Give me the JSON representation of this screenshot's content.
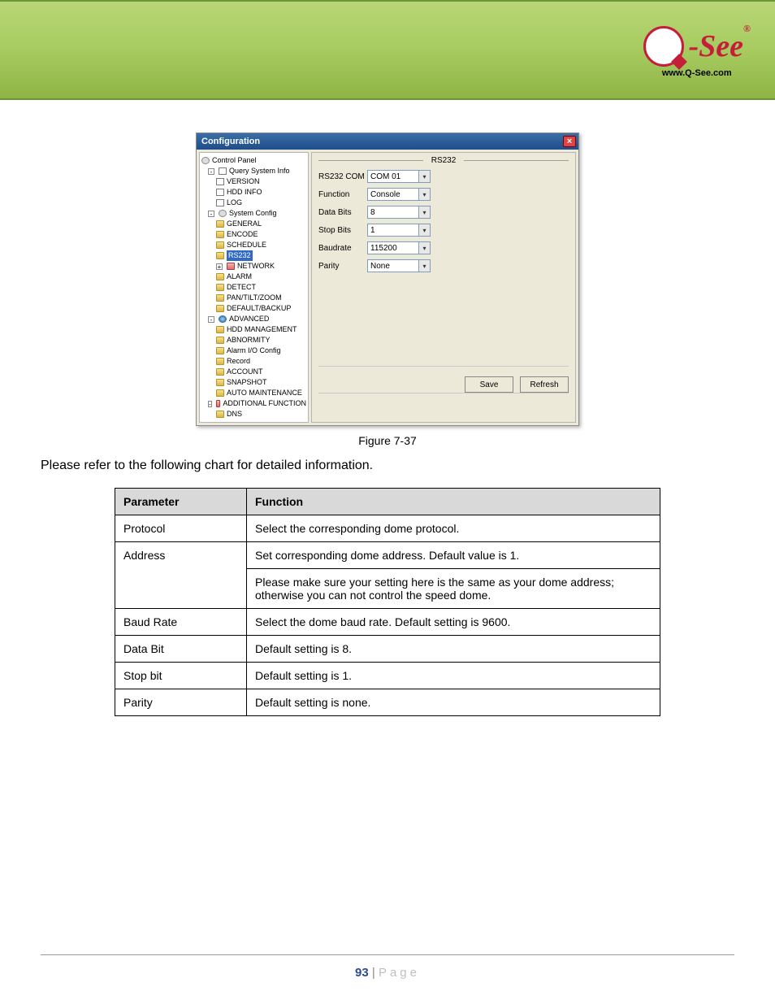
{
  "header": {
    "logo_url": "www.Q-See.com",
    "logo_dash": "-",
    "logo_text": "See",
    "logo_reg": "®"
  },
  "window": {
    "title": "Configuration",
    "panel_title": "RS232",
    "buttons": {
      "save": "Save",
      "refresh": "Refresh"
    },
    "fields": {
      "rscom": {
        "label": "RS232 COM",
        "value": "COM 01"
      },
      "function": {
        "label": "Function",
        "value": "Console"
      },
      "databits": {
        "label": "Data Bits",
        "value": "8"
      },
      "stopbits": {
        "label": "Stop Bits",
        "value": "1"
      },
      "baudrate": {
        "label": "Baudrate",
        "value": "115200"
      },
      "parity": {
        "label": "Parity",
        "value": "None"
      }
    },
    "tree": {
      "root": "Control Panel",
      "items": [
        {
          "label": "Query System Info",
          "level": 1,
          "expander": "-",
          "icon": "sheet"
        },
        {
          "label": "VERSION",
          "level": 2,
          "icon": "sheet"
        },
        {
          "label": "HDD INFO",
          "level": 2,
          "icon": "sheet"
        },
        {
          "label": "LOG",
          "level": 2,
          "icon": "sheet"
        },
        {
          "label": "System Config",
          "level": 1,
          "expander": "-",
          "icon": "gear"
        },
        {
          "label": "GENERAL",
          "level": 2,
          "icon": "folder"
        },
        {
          "label": "ENCODE",
          "level": 2,
          "icon": "folder"
        },
        {
          "label": "SCHEDULE",
          "level": 2,
          "icon": "folder"
        },
        {
          "label": "RS232",
          "level": 2,
          "icon": "folder",
          "selected": true
        },
        {
          "label": "NETWORK",
          "level": 2,
          "expander": "+",
          "icon": "folder-red"
        },
        {
          "label": "ALARM",
          "level": 2,
          "icon": "folder"
        },
        {
          "label": "DETECT",
          "level": 2,
          "icon": "folder"
        },
        {
          "label": "PAN/TILT/ZOOM",
          "level": 2,
          "icon": "folder"
        },
        {
          "label": "DEFAULT/BACKUP",
          "level": 2,
          "icon": "folder"
        },
        {
          "label": "ADVANCED",
          "level": 1,
          "expander": "-",
          "icon": "globe"
        },
        {
          "label": "HDD MANAGEMENT",
          "level": 2,
          "icon": "folder"
        },
        {
          "label": "ABNORMITY",
          "level": 2,
          "icon": "folder"
        },
        {
          "label": "Alarm I/O Config",
          "level": 2,
          "icon": "folder"
        },
        {
          "label": "Record",
          "level": 2,
          "icon": "folder"
        },
        {
          "label": "ACCOUNT",
          "level": 2,
          "icon": "folder"
        },
        {
          "label": "SNAPSHOT",
          "level": 2,
          "icon": "folder"
        },
        {
          "label": "AUTO MAINTENANCE",
          "level": 2,
          "icon": "folder"
        },
        {
          "label": "ADDITIONAL FUNCTION",
          "level": 1,
          "expander": "-",
          "icon": "folder-red"
        },
        {
          "label": "DNS",
          "level": 2,
          "icon": "folder"
        }
      ]
    }
  },
  "caption": "Figure 7-37",
  "intro": "Please refer to the following chart for detailed information.",
  "table": {
    "headers": {
      "param": "Parameter",
      "func": "Function"
    },
    "rows": [
      {
        "param": "Protocol",
        "func": "Select the corresponding dome protocol."
      },
      {
        "param": "Address",
        "func_a": "Set corresponding dome address. Default value is 1.",
        "func_b": "Please make sure your setting here is the same as your dome address; otherwise you can not control the speed dome."
      },
      {
        "param": "Baud Rate",
        "func": "Select the dome baud rate. Default setting is 9600."
      },
      {
        "param": "Data Bit",
        "func": "Default setting is 8."
      },
      {
        "param": "Stop bit",
        "func": "Default setting is 1."
      },
      {
        "param": "Parity",
        "func": "Default setting is none."
      }
    ]
  },
  "footer": {
    "page": "93",
    "sep": " | ",
    "label": "Page"
  }
}
